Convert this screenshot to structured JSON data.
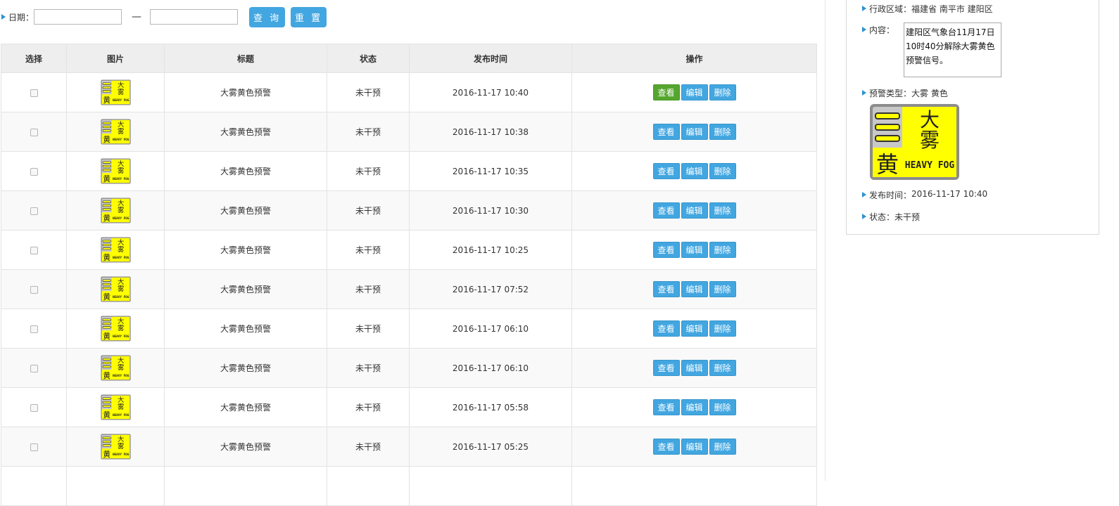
{
  "filter": {
    "date_label": "日期：",
    "start_value": "",
    "end_value": "",
    "separator": "—",
    "query_label": "查 询",
    "reset_label": "重 置"
  },
  "table": {
    "headers": [
      "选择",
      "图片",
      "标题",
      "状态",
      "发布时间",
      "操作"
    ],
    "rows": [
      {
        "title": "大雾黄色预警",
        "status": "未干预",
        "time": "2016-11-17 10:40"
      },
      {
        "title": "大雾黄色预警",
        "status": "未干预",
        "time": "2016-11-17 10:38"
      },
      {
        "title": "大雾黄色预警",
        "status": "未干预",
        "time": "2016-11-17 10:35"
      },
      {
        "title": "大雾黄色预警",
        "status": "未干预",
        "time": "2016-11-17 10:30"
      },
      {
        "title": "大雾黄色预警",
        "status": "未干预",
        "time": "2016-11-17 10:25"
      },
      {
        "title": "大雾黄色预警",
        "status": "未干预",
        "time": "2016-11-17 07:52"
      },
      {
        "title": "大雾黄色预警",
        "status": "未干预",
        "time": "2016-11-17 06:10"
      },
      {
        "title": "大雾黄色预警",
        "status": "未干预",
        "time": "2016-11-17 06:10"
      },
      {
        "title": "大雾黄色预警",
        "status": "未干预",
        "time": "2016-11-17 05:58"
      },
      {
        "title": "大雾黄色预警",
        "status": "未干预",
        "time": "2016-11-17 05:25"
      }
    ],
    "actions": {
      "view": "查看",
      "edit": "编辑",
      "delete": "删除"
    },
    "active_view_row": 0
  },
  "detail": {
    "region_label": "行政区域：",
    "region_value": "福建省 南平市 建阳区",
    "content_label": "内容：",
    "content_value": "建阳区气象台11月17日10时40分解除大雾黄色预警信号。",
    "type_label": "预警类型：",
    "type_value": "大雾 黄色",
    "time_label": "发布时间：",
    "time_value": "2016-11-17 10:40",
    "status_label": "状态：",
    "status_value": "未干预"
  },
  "icon": {
    "name": "heavy-fog-yellow-warning-icon",
    "char_big": "大",
    "char_fog": "雾",
    "char_yellow": "黄",
    "text_en": "HEAVY FOG"
  },
  "colors": {
    "accent_blue": "#42a6e0",
    "view_active_green": "#55a62f",
    "warning_yellow": "#ffff00",
    "marker_blue": "#2a93d5"
  }
}
